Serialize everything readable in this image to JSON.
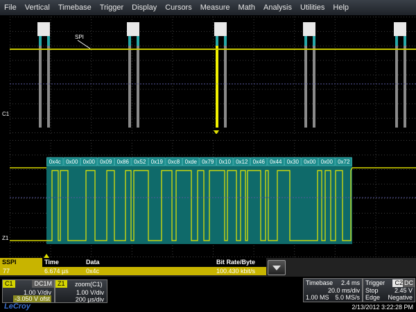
{
  "menu": [
    "File",
    "Vertical",
    "Timebase",
    "Trigger",
    "Display",
    "Cursors",
    "Measure",
    "Math",
    "Analysis",
    "Utilities",
    "Help"
  ],
  "trace_labels": {
    "spi": "SPI",
    "c1": "C1",
    "z1": "Z1"
  },
  "decode_bytes": [
    "0x4c",
    "0x00",
    "0x00",
    "0x09",
    "0x86",
    "0x52",
    "0x19",
    "0xc8",
    "0xde",
    "0x79",
    "0x10",
    "0x12",
    "0x46",
    "0x44",
    "0x30",
    "0x00",
    "0x00",
    "0x72"
  ],
  "table": {
    "headers": {
      "name": "SSPI",
      "time": "Time",
      "data": "Data",
      "rate": "Bit Rate/Byte"
    },
    "row": {
      "index": "77",
      "time": "6.674 µs",
      "data": "0x4c",
      "rate": "100.430 kbit/s"
    }
  },
  "channel_c1": {
    "name": "C1",
    "coupling": "DC1M",
    "vdiv": "1.00 V/div",
    "offset": "-3.050 V ofst"
  },
  "channel_z1": {
    "name": "Z1",
    "title": "zoom(C1)",
    "vdiv": "1.00 V/div",
    "tdiv": "200 µs/div"
  },
  "timebase": {
    "label": "Timebase",
    "delay": "2.4 ms",
    "tdiv": "20.0 ms/div",
    "samples": "1.00 MS",
    "rate": "5.0 MS/s"
  },
  "trigger": {
    "label": "Trigger",
    "channel": "C2",
    "coupling": "DC",
    "mode": "Stop",
    "level": "2.45 V",
    "type": "Edge",
    "slope": "Negative"
  },
  "datetime": "2/13/2012 3:22:28 PM",
  "brand": "LeCroy",
  "colors": {
    "trace": "#d4d400",
    "accent_cyan": "#26a8a8",
    "dec_box": "#0f6a6a"
  }
}
